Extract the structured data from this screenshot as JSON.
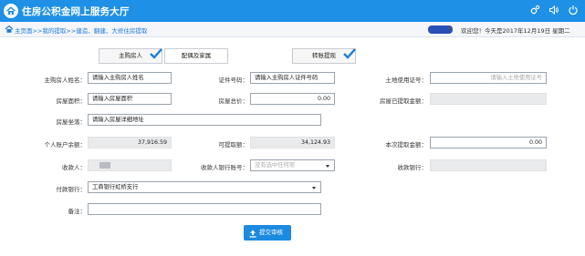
{
  "app": {
    "title": "住房公积金网上服务大厅"
  },
  "header": {
    "icons": [
      "settings-icon",
      "volume-icon",
      "power-icon"
    ]
  },
  "breadcrumb": {
    "home": "主页面",
    "sep1": ">>",
    "item1": "我的提取",
    "sep2": ">>",
    "item2": "建造、翻建、大修住房提取"
  },
  "welcome": {
    "text": "欢迎您！今天是2017年12月19日 星期二"
  },
  "toggles": {
    "main_buyer": "主购房人",
    "spouse_family": "配偶及家属",
    "transfer_withdraw": "转账提现"
  },
  "form": {
    "buyer_name": {
      "label": "主购房人姓名：",
      "value": "请输入主购房人姓名"
    },
    "id_number": {
      "label": "证件号码：",
      "value": "请输入主购房人证件号码"
    },
    "land_cert": {
      "label": "土地使用证号：",
      "placeholder": "请输入土地使用证号"
    },
    "house_area": {
      "label": "房屋面积：",
      "value": "请输入房屋面积"
    },
    "house_price": {
      "label": "房屋总价：",
      "value": "0.00"
    },
    "house_withdrawn": {
      "label": "房屋已提取金额：",
      "value": ""
    },
    "house_location": {
      "label": "房屋坐落：",
      "value": "请输入房屋详细地址"
    },
    "account_balance": {
      "label": "个人账户余额：",
      "value": "37,916.59"
    },
    "withdrawable": {
      "label": "可提取额：",
      "value": "34,124.93"
    },
    "this_withdraw": {
      "label": "本次提取金额：",
      "value": "0.00"
    },
    "payee": {
      "label": "收款人：",
      "value": ""
    },
    "payee_account": {
      "label": "收款人银行账号：",
      "placeholder": "没有选中任何项"
    },
    "payee_bank": {
      "label": "收款银行：",
      "value": ""
    },
    "pay_bank": {
      "label": "付款银行：",
      "value": "工商银行虹桥支行"
    },
    "remark": {
      "label": "备注：",
      "value": ""
    }
  },
  "actions": {
    "submit": "提交审核"
  },
  "colors": {
    "header": "#1e90e6",
    "accent": "#1c8ae0",
    "check": "#1a7fd8"
  }
}
